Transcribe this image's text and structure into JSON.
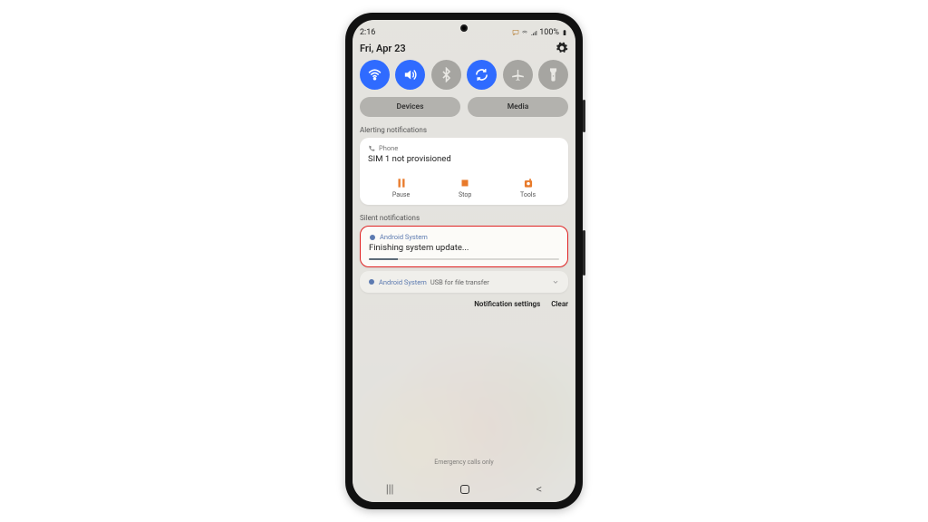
{
  "status": {
    "time": "2:16",
    "battery": "100%"
  },
  "date": "Fri, Apr 23",
  "quick_toggles": [
    {
      "name": "wifi",
      "on": true
    },
    {
      "name": "sound",
      "on": true
    },
    {
      "name": "bluetooth",
      "on": false
    },
    {
      "name": "rotate",
      "on": true
    },
    {
      "name": "airplane",
      "on": false
    },
    {
      "name": "flashlight",
      "on": false
    }
  ],
  "panels": {
    "devices": "Devices",
    "media": "Media"
  },
  "sections": {
    "alerting": "Alerting notifications",
    "silent": "Silent notifications"
  },
  "notif_phone": {
    "source": "Phone",
    "message": "SIM 1 not provisioned",
    "actions": {
      "pause": "Pause",
      "stop": "Stop",
      "tools": "Tools"
    }
  },
  "notif_update": {
    "source": "Android System",
    "message": "Finishing system update...",
    "progress_pct": 15
  },
  "notif_usb": {
    "source": "Android System",
    "message": "USB for file transfer"
  },
  "footer": {
    "settings": "Notification settings",
    "clear": "Clear",
    "emergency": "Emergency calls only"
  },
  "colors": {
    "accent_blue": "#2f6bff",
    "accent_orange": "#e87a2a",
    "highlight": "#e02424"
  }
}
